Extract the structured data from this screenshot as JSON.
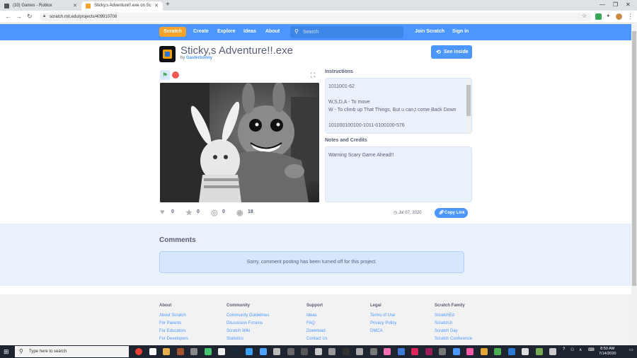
{
  "browser": {
    "tabs": [
      {
        "title": "(33) Games - Roblox",
        "color": "#555"
      },
      {
        "title": "Sticky,s Adventure!!.exe on Sc",
        "color": "#f7a32a"
      }
    ],
    "url": "scratch.mit.edu/projects/409910708"
  },
  "navbar": {
    "logo": "Scratch",
    "links": [
      "Create",
      "Explore",
      "Ideas",
      "About"
    ],
    "search_placeholder": "Search",
    "join": "Join Scratch",
    "signin": "Sign in"
  },
  "project": {
    "title": "Sticky,s Adventure!!.exe",
    "by_label": "by",
    "author": "Gasterbonny",
    "see_inside": "See inside",
    "instructions_title": "Instructions",
    "instructions_lines": [
      "1011001-62",
      "",
      "W,S,D,A - To move",
      "W - To climb up That Things, But u can,t come Back Down",
      "",
      "101000100100-1011-0100100-576"
    ],
    "notes_title": "Notes and Credits",
    "notes": "Warning Scary Game Ahead!!",
    "stats": {
      "loves": "0",
      "favorites": "0",
      "remixes": "0",
      "views": "18"
    },
    "date": "Jul 07, 2020",
    "copy_link": "Copy Link"
  },
  "comments": {
    "title": "Comments",
    "notice": "Sorry, comment posting has been turned off for this project."
  },
  "footer": {
    "columns": [
      {
        "title": "About",
        "links": [
          "About Scratch",
          "For Parents",
          "For Educators",
          "For Developers"
        ]
      },
      {
        "title": "Community",
        "links": [
          "Community Guidelines",
          "Discussion Forums",
          "Scratch Wiki",
          "Statistics"
        ]
      },
      {
        "title": "Support",
        "links": [
          "Ideas",
          "FAQ",
          "Download",
          "Contact Us"
        ]
      },
      {
        "title": "Legal",
        "links": [
          "Terms of Use",
          "Privacy Policy",
          "DMCA"
        ]
      },
      {
        "title": "Scratch Family",
        "links": [
          "ScratchEd",
          "ScratchJr",
          "Scratch Day",
          "Scratch Conference"
        ]
      }
    ]
  },
  "taskbar": {
    "search_placeholder": "Type here to search",
    "time": "8:50 AM",
    "date": "7/14/2020"
  },
  "colors": {
    "accent": "#4c97ff",
    "brand": "#f7a32a"
  }
}
